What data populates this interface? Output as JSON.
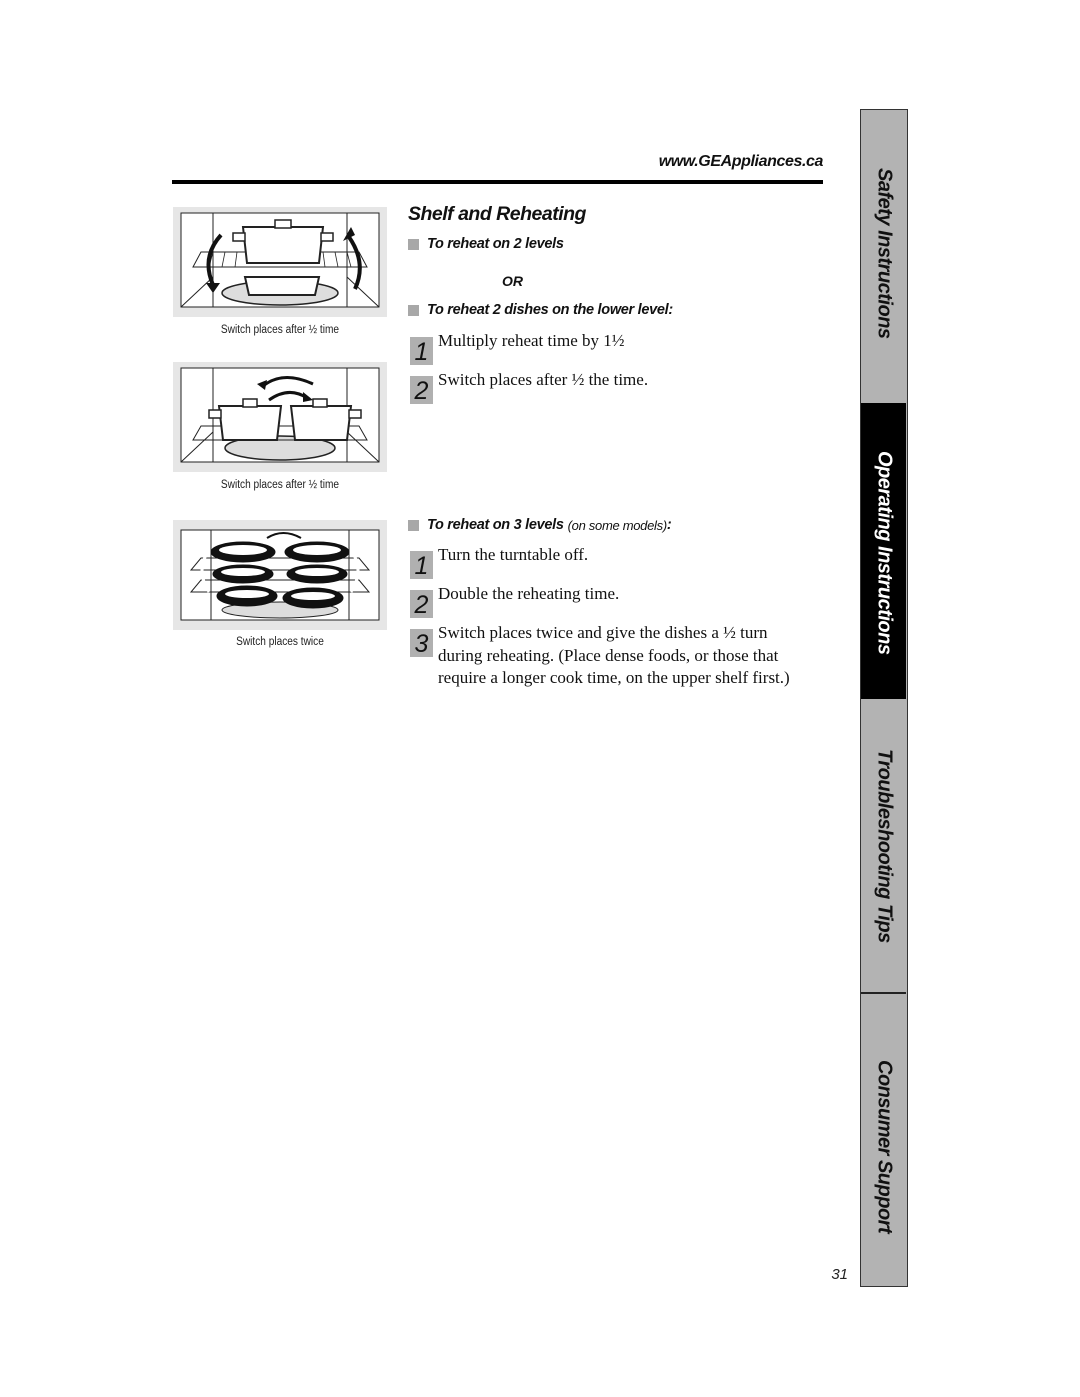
{
  "header": {
    "site_url": "www.GEAppliances.ca"
  },
  "figures": [
    {
      "caption": "Switch places after ½ time",
      "illustration": "two-level-shelf-switch-icon"
    },
    {
      "caption": "Switch places after ½ time",
      "illustration": "two-dishes-lower-level-switch-icon"
    },
    {
      "caption": "Switch places twice",
      "illustration": "three-level-shelf-switch-icon"
    }
  ],
  "main": {
    "title": "Shelf and Reheating",
    "section1": {
      "heading_a": "To reheat on 2 levels",
      "or_label": "OR",
      "heading_b": "To reheat 2 dishes on the lower level:",
      "steps": [
        {
          "number": "1",
          "text": "Multiply reheat time by 1½"
        },
        {
          "number": "2",
          "text": "Switch places after ½ the time."
        }
      ]
    },
    "section2": {
      "heading": "To reheat on 3 levels",
      "heading_note": "(on some models)",
      "heading_colon": ":",
      "steps": [
        {
          "number": "1",
          "text": "Turn the turntable off."
        },
        {
          "number": "2",
          "text": "Double the reheating time."
        },
        {
          "number": "3",
          "text": "Switch places twice and give the dishes a ½ turn during reheating. (Place dense foods, or those that require a longer cook time, on the upper shelf first.)"
        }
      ]
    }
  },
  "side_tabs": [
    {
      "label": "Safety Instructions",
      "active": false
    },
    {
      "label": "Operating Instructions",
      "active": true
    },
    {
      "label": "Troubleshooting Tips",
      "active": false
    },
    {
      "label": "Consumer Support",
      "active": false
    }
  ],
  "footer": {
    "page_number": "31"
  }
}
